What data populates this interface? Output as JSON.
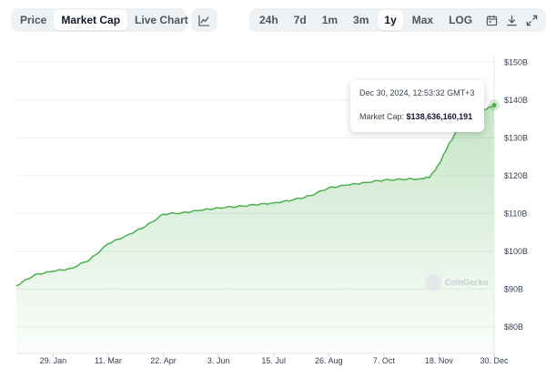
{
  "toolbar": {
    "tabs": [
      {
        "label": "Price",
        "active": false
      },
      {
        "label": "Market Cap",
        "active": true
      },
      {
        "label": "Live Chart",
        "active": false,
        "external": "external-link-icon"
      }
    ],
    "chart_toggle_icon": "line-chart-icon",
    "ranges": [
      {
        "label": "24h",
        "active": false
      },
      {
        "label": "7d",
        "active": false
      },
      {
        "label": "1m",
        "active": false
      },
      {
        "label": "3m",
        "active": false
      },
      {
        "label": "1y",
        "active": true
      },
      {
        "label": "Max",
        "active": false
      },
      {
        "label": "LOG",
        "active": false
      }
    ],
    "icons": [
      "calendar-icon",
      "download-icon",
      "expand-icon"
    ]
  },
  "tooltip": {
    "datetime": "Dec 30, 2024, 12:53:32 GMT+3",
    "label": "Market Cap:",
    "value": "$138,636,160,191"
  },
  "watermark": "CoinGecko",
  "chart_data": {
    "type": "area",
    "x": [
      "2024-01-01",
      "2024-01-15",
      "2024-01-29",
      "2024-02-12",
      "2024-02-26",
      "2024-03-11",
      "2024-03-25",
      "2024-04-08",
      "2024-04-22",
      "2024-05-06",
      "2024-05-20",
      "2024-06-03",
      "2024-06-17",
      "2024-07-01",
      "2024-07-15",
      "2024-07-29",
      "2024-08-12",
      "2024-08-26",
      "2024-09-09",
      "2024-09-23",
      "2024-10-07",
      "2024-10-21",
      "2024-11-04",
      "2024-11-11",
      "2024-11-18",
      "2024-11-25",
      "2024-12-02",
      "2024-12-09",
      "2024-12-16",
      "2024-12-23",
      "2024-12-30"
    ],
    "values": [
      90.9,
      93.8,
      94.7,
      95.5,
      97.8,
      102.0,
      104.2,
      106.5,
      109.8,
      110.2,
      110.8,
      111.5,
      111.8,
      112.3,
      112.8,
      113.5,
      114.7,
      116.8,
      117.5,
      118.2,
      118.8,
      119.0,
      119.2,
      119.6,
      123.0,
      128.0,
      132.0,
      134.5,
      136.0,
      137.5,
      138.64
    ],
    "y_ticks": [
      "$80B",
      "$90B",
      "$100B",
      "$110B",
      "$120B",
      "$130B",
      "$140B",
      "$150B"
    ],
    "y_tick_values": [
      80,
      90,
      100,
      110,
      120,
      130,
      140,
      150
    ],
    "ylim": [
      73,
      152
    ],
    "x_ticks": [
      "29. Jan",
      "11. Mar",
      "22. Apr",
      "3. Jun",
      "15. Jul",
      "26. Aug",
      "7. Oct",
      "18. Nov",
      "30. Dec"
    ],
    "x_tick_dates": [
      "2024-01-29",
      "2024-03-11",
      "2024-04-22",
      "2024-06-03",
      "2024-07-15",
      "2024-08-26",
      "2024-10-07",
      "2024-11-18",
      "2024-12-30"
    ],
    "grid": true,
    "color": "#4caf50"
  }
}
